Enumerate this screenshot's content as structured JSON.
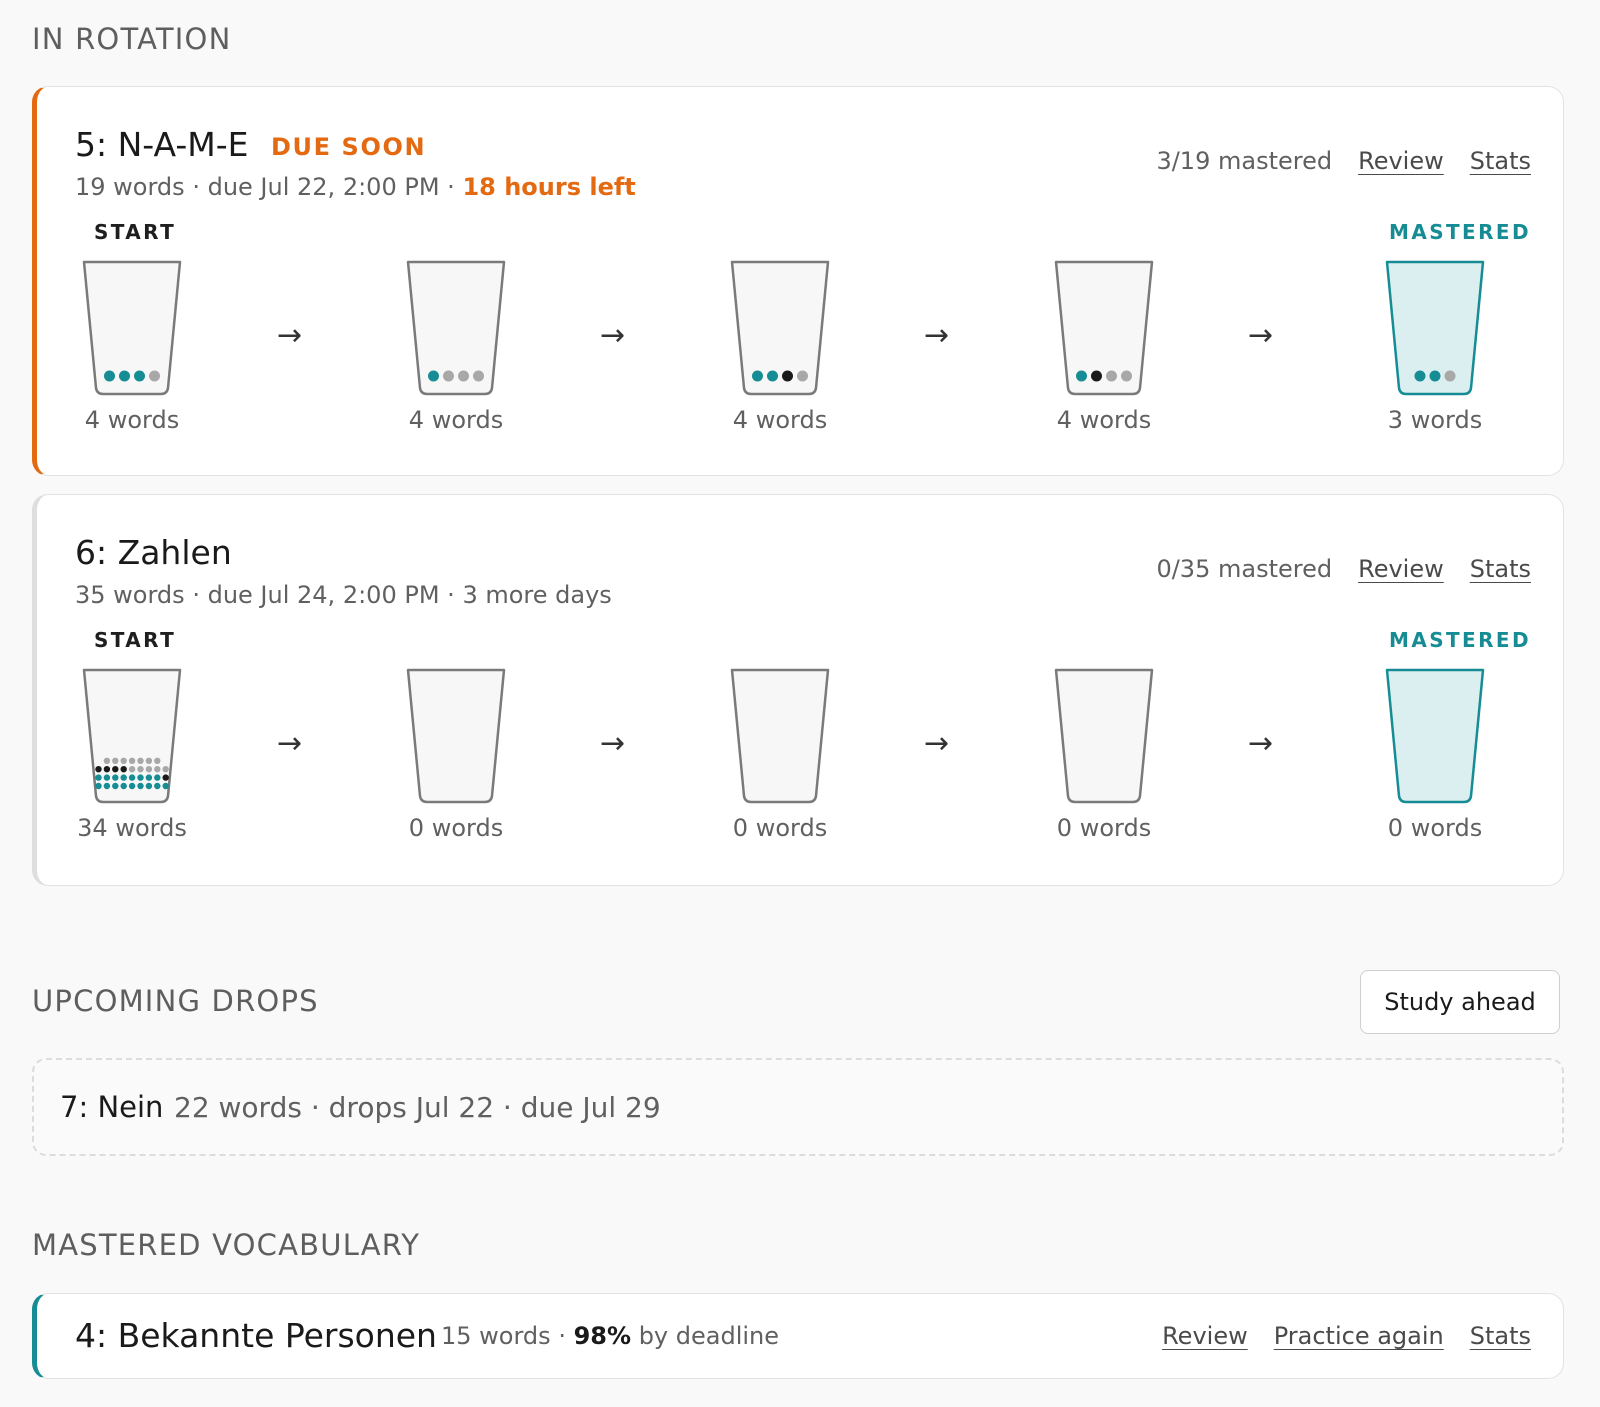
{
  "sections": {
    "in_rotation": "IN ROTATION",
    "upcoming": "UPCOMING DROPS",
    "mastered_vocab": "MASTERED VOCABULARY"
  },
  "colors": {
    "accent_orange": "#e46a12",
    "accent_teal": "#168c94",
    "dot_teal": "#168c94",
    "dot_black": "#1a1a1a",
    "dot_grey": "#a8a8a8",
    "mastered_fill": "#dbeef0"
  },
  "decks": [
    {
      "title": "5: N-A-M-E",
      "badge": "DUE SOON",
      "words": "19 words",
      "due": "due Jul 22, 2:00 PM",
      "time_left": "18 hours left",
      "mastered": "3/19 mastered",
      "review": "Review",
      "stats": "Stats",
      "start_label": "START",
      "mastered_label": "MASTERED",
      "boxes": [
        {
          "count": "4 words",
          "dots": [
            "teal",
            "teal",
            "teal",
            "grey"
          ]
        },
        {
          "count": "4 words",
          "dots": [
            "teal",
            "grey",
            "grey",
            "grey"
          ]
        },
        {
          "count": "4 words",
          "dots": [
            "teal",
            "teal",
            "black",
            "grey"
          ]
        },
        {
          "count": "4 words",
          "dots": [
            "teal",
            "black",
            "grey",
            "grey"
          ]
        },
        {
          "count": "3 words",
          "dots": [
            "teal",
            "teal",
            "grey"
          ]
        }
      ]
    },
    {
      "title": "6: Zahlen",
      "words": "35 words",
      "due": "due Jul 24, 2:00 PM",
      "time_left": "3 more days",
      "mastered": "0/35 mastered",
      "review": "Review",
      "stats": "Stats",
      "start_label": "START",
      "mastered_label": "MASTERED",
      "boxes": [
        {
          "count": "34 words",
          "dots_teal": 17,
          "dots_black": 5,
          "dots_grey": 12
        },
        {
          "count": "0 words"
        },
        {
          "count": "0 words"
        },
        {
          "count": "0 words"
        },
        {
          "count": "0 words"
        }
      ]
    }
  ],
  "study_ahead": "Study ahead",
  "upcoming": {
    "title": "7: Nein",
    "sub": "22 words · drops Jul 22 · due Jul 29"
  },
  "mastered": {
    "title": "4: Bekannte Personen",
    "words": "15 words",
    "percent": "98%",
    "by_deadline": "by deadline",
    "review": "Review",
    "practice": "Practice again",
    "stats": "Stats"
  },
  "arrow_glyph": "→",
  "separator": "·"
}
